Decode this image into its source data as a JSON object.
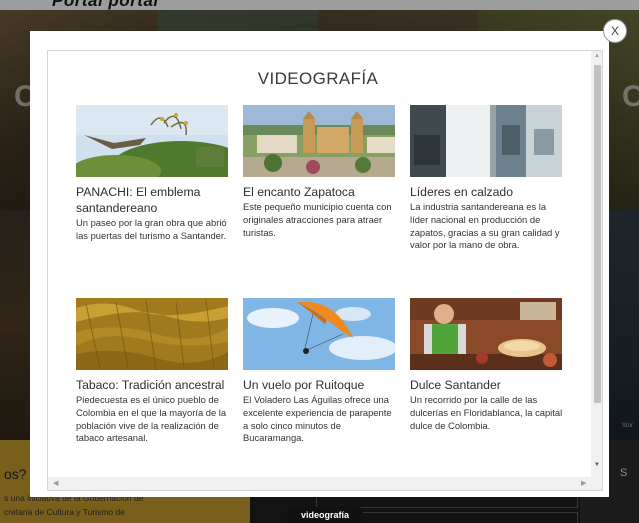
{
  "background": {
    "portal_title": "Portal portal",
    "side_letter": "C",
    "bottom_heading": "os?",
    "bottom_line_1": "s una iniciativa de la Gobernación de",
    "bottom_line_2": "cretaria de Cultura y Turismo de",
    "right_letter": "S",
    "stores_label": "Stor",
    "footer_tab": "videografía"
  },
  "modal": {
    "title": "VIDEOGRAFÍA",
    "close_label": "X",
    "videos": [
      {
        "title": "PANACHI: El emblema santandereano",
        "description": "Un paseo por la gran obra que abrió las puertas del turismo a Santander."
      },
      {
        "title": "El encanto Zapatoca",
        "description": "Este pequeño municipio cuenta con originales atracciones para atraer turistas."
      },
      {
        "title": "Líderes en calzado",
        "description": "La industria santandereana es la líder nacional en producción de zapatos, gracias a su gran calidad y valor por la mano de obra."
      },
      {
        "title": "Tabaco: Tradición ancestral",
        "description": "Piedecuesta es el único pueblo de Colombia en el que la mayoría de la población vive de la realización de tabaco artesanal."
      },
      {
        "title": "Un vuelo por Ruitoque",
        "description": "El Voladero Las Águilas ofrece una excelente experiencia de parapente a solo cinco minutos de Bucaramanga."
      },
      {
        "title": "Dulce Santander",
        "description": "Un recorrido por la calle de las dulcerías en Floridablanca, la capital dulce de Colombia."
      }
    ]
  },
  "icons": {
    "close": "close-icon",
    "scroll_up": "chevron-up-icon",
    "scroll_down": "chevron-down-icon",
    "scroll_left": "chevron-left-icon",
    "scroll_right": "chevron-right-icon"
  }
}
